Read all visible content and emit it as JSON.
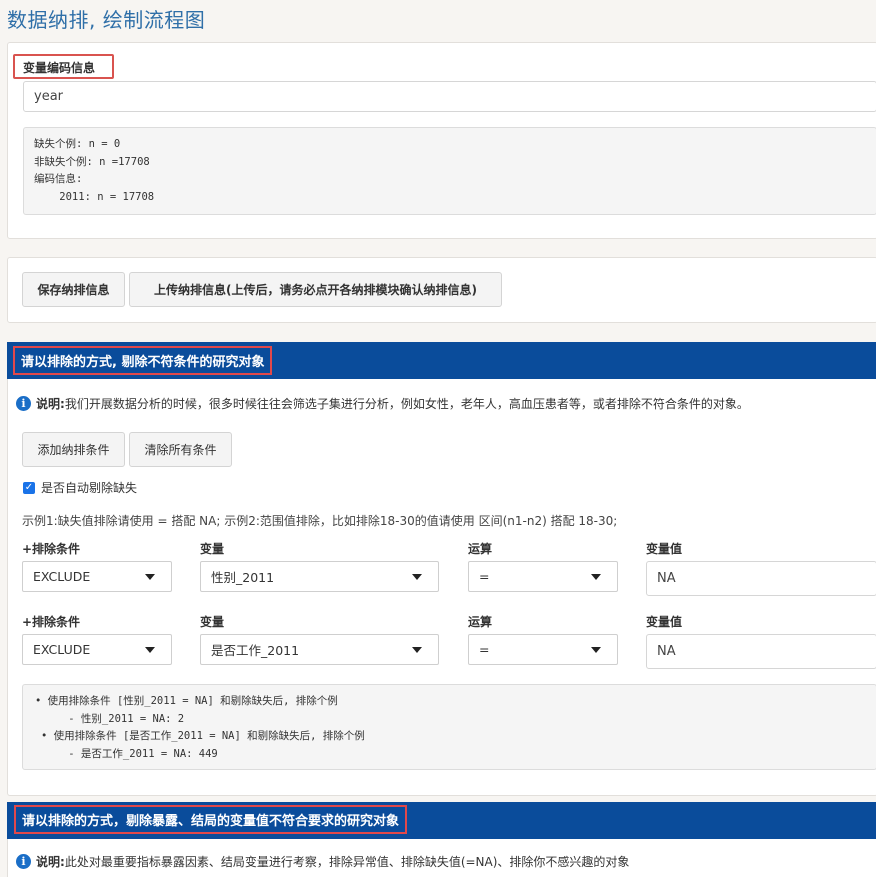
{
  "page": {
    "title": "数据纳排, 绘制流程图"
  },
  "encoding": {
    "label": "变量编码信息",
    "input_value": "year",
    "pre_lines": [
      "缺失个例: n = 0",
      "非缺失个例: n =17708",
      "编码信息:",
      "    2011: n = 17708"
    ]
  },
  "actions": {
    "save_label": "保存纳排信息",
    "upload_label": "上传纳排信息(上传后，请务必点开各纳排模块确认纳排信息)"
  },
  "section1": {
    "title": "请以排除的方式, 剔除不符条件的研究对象",
    "info_prefix": "说明:",
    "info_text": " 我们开展数据分析的时候，很多时候往往会筛选子集进行分析，例如女性，老年人，高血压患者等，或者排除不符合条件的对象。",
    "add_label": "添加纳排条件",
    "clear_label": "清除所有条件",
    "auto_missing_label": "是否自动剔除缺失",
    "example_text": "示例1:缺失值排除请使用 = 搭配 NA; 示例2:范围值排除，比如排除18-30的值请使用 区间(n1-n2) 搭配 18-30;",
    "columns": {
      "condition": "+排除条件",
      "variable": "变量",
      "operator": "运算",
      "value": "变量值"
    },
    "rows": [
      {
        "condition": "EXCLUDE",
        "variable": "性别_2011",
        "operator": "=",
        "value": "NA"
      },
      {
        "condition": "EXCLUDE",
        "variable": "是否工作_2011",
        "operator": "=",
        "value": "NA"
      }
    ],
    "results": [
      "• 使用排除条件 [性别_2011 = NA] 和剔除缺失后, 排除个例",
      "    - 性别_2011 = NA: 2",
      "• 使用排除条件 [是否工作_2011 = NA] 和剔除缺失后, 排除个例",
      "    - 是否工作_2011 = NA: 449"
    ]
  },
  "section2": {
    "title": "请以排除的方式，剔除暴露、结局的变量值不符合要求的研究对象",
    "info_prefix": "说明:",
    "info_text": "此处对最重要指标暴露因素、结局变量进行考察，排除异常值、排除缺失值(=NA)、排除你不感兴趣的对象"
  }
}
